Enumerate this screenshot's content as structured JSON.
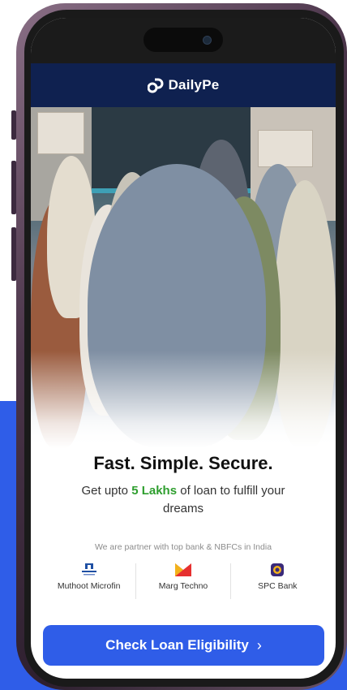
{
  "colors": {
    "header_bg": "#0f2150",
    "accent": "#2f5de8",
    "highlight": "#2e9e2e",
    "frame": "#4b354a"
  },
  "app": {
    "name": "DailyPe",
    "logo_icon": "dailype-logo-icon"
  },
  "hero": {
    "image": "group-of-smiling-men-photo"
  },
  "content": {
    "headline": "Fast. Simple. Secure.",
    "sub_prefix": "Get upto",
    "sub_highlight": "5 Lakhs",
    "sub_suffix": "of loan to fulfill your dreams"
  },
  "partners": {
    "note": "We are partner with top bank & NBFCs in India",
    "items": [
      {
        "name": "Muthoot Microfin",
        "icon": "muthoot-logo-icon"
      },
      {
        "name": "Marg Techno",
        "icon": "marg-logo-icon"
      },
      {
        "name": "SPC Bank",
        "icon": "spc-bank-logo-icon"
      }
    ]
  },
  "cta": {
    "label": "Check Loan Eligibility",
    "icon": "chevron-right-icon"
  }
}
